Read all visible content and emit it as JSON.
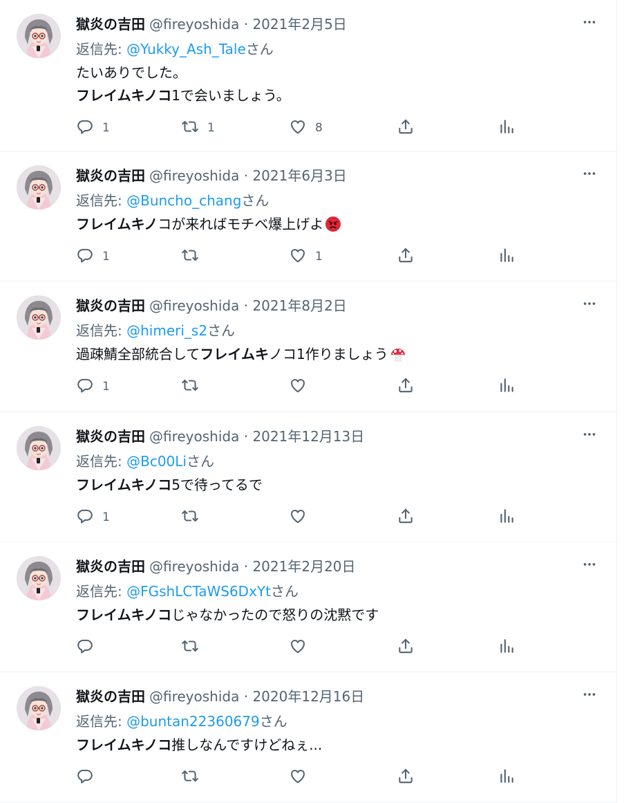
{
  "colors": {
    "accent": "#1d9bf0",
    "secondary_text": "#536471",
    "text": "#0f1419",
    "border": "#eff3f4"
  },
  "icons": [
    "avatar-image",
    "more-icon",
    "reply-icon",
    "retweet-icon",
    "like-icon",
    "share-icon",
    "analytics-icon"
  ],
  "tweets": [
    {
      "name": "獄炎の吉田",
      "handle": "@fireyoshida",
      "sep": "·",
      "date": "2021年2月5日",
      "reply_prefix": "返信先: ",
      "mention": "@Yukky_Ash_Tale",
      "reply_suffix": "さん",
      "line1": "たいありでした。",
      "bold": "フレイムキノコ",
      "rest": "1で会いましょう。",
      "reply_count": "1",
      "retweet_count": "1",
      "like_count": "8"
    },
    {
      "name": "獄炎の吉田",
      "handle": "@fireyoshida",
      "sep": "·",
      "date": "2021年6月3日",
      "reply_prefix": "返信先: ",
      "mention": "@Buncho_chang",
      "reply_suffix": "さん",
      "bold": "フレイムキノ",
      "rest": "コが来ればモチベ爆上げよ",
      "emoji": "angry-face-emoji",
      "reply_count": "1",
      "retweet_count": "",
      "like_count": "1"
    },
    {
      "name": "獄炎の吉田",
      "handle": "@fireyoshida",
      "sep": "·",
      "date": "2021年8月2日",
      "reply_prefix": "返信先: ",
      "mention": "@himeri_s2",
      "reply_suffix": "さん",
      "pre": "過疎鯖全部統合して",
      "bold": "フレイムキ",
      "rest": "ノコ1作りましょう",
      "emoji": "mushroom-emoji",
      "reply_count": "1",
      "retweet_count": "",
      "like_count": ""
    },
    {
      "name": "獄炎の吉田",
      "handle": "@fireyoshida",
      "sep": "·",
      "date": "2021年12月13日",
      "reply_prefix": "返信先: ",
      "mention": "@Bc00Li",
      "reply_suffix": "さん",
      "bold": "フレイムキノコ",
      "rest": "5で待ってるで",
      "reply_count": "1",
      "retweet_count": "",
      "like_count": ""
    },
    {
      "name": "獄炎の吉田",
      "handle": "@fireyoshida",
      "sep": "·",
      "date": "2021年2月20日",
      "reply_prefix": "返信先: ",
      "mention": "@FGshLCTaWS6DxYt",
      "reply_suffix": "さん",
      "bold": "フレイムキノコ",
      "rest": "じゃなかったので怒りの沈黙です",
      "reply_count": "",
      "retweet_count": "",
      "like_count": ""
    },
    {
      "name": "獄炎の吉田",
      "handle": "@fireyoshida",
      "sep": "·",
      "date": "2020年12月16日",
      "reply_prefix": "返信先: ",
      "mention": "@buntan22360679",
      "reply_suffix": "さん",
      "bold": "フレイムキノコ",
      "rest": "推しなんですけどねぇ...",
      "reply_count": "",
      "retweet_count": "",
      "like_count": ""
    }
  ]
}
